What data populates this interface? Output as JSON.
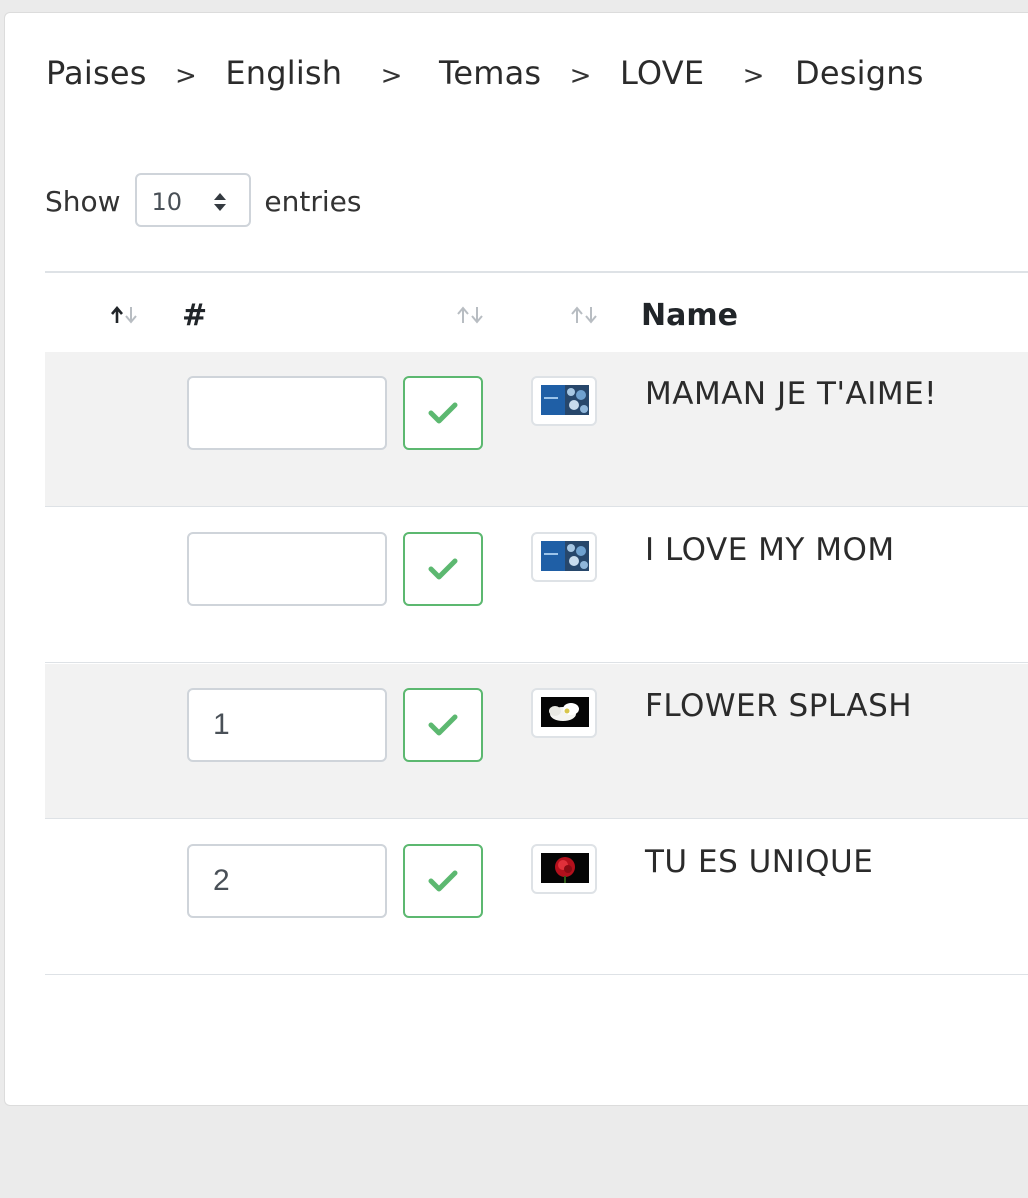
{
  "breadcrumb": {
    "items": [
      "Paises",
      "English",
      "Temas",
      "LOVE",
      "Designs"
    ],
    "separator": ">"
  },
  "length_control": {
    "show_label": "Show",
    "selected_value": "10",
    "entries_label": "entries"
  },
  "table": {
    "columns": [
      {
        "key": "sort",
        "label": "",
        "sort_state": "ascending"
      },
      {
        "key": "order",
        "label": "#",
        "sort_state": "none"
      },
      {
        "key": "image",
        "label": "",
        "sort_state": "none"
      },
      {
        "key": "name",
        "label": "Name",
        "sort_state": "none"
      }
    ],
    "rows": [
      {
        "order_value": "",
        "thumbnail": "blue-card-thumbnail",
        "name": "MAMAN JE T'AIME!"
      },
      {
        "order_value": "",
        "thumbnail": "blue-card-thumbnail",
        "name": "I LOVE MY MOM"
      },
      {
        "order_value": "1",
        "thumbnail": "white-flower-thumbnail",
        "name": "FLOWER SPLASH"
      },
      {
        "order_value": "2",
        "thumbnail": "red-rose-thumbnail",
        "name": "TU ES UNIQUE"
      }
    ]
  },
  "colors": {
    "page_background": "#ebebeb",
    "card_background": "#ffffff",
    "stripe": "#f2f2f2",
    "confirm_green": "#5cb870",
    "border": "#dee2e6"
  },
  "icons": {
    "confirm": "check-icon",
    "sort": "sort-arrows-icon",
    "select": "select-arrows-icon"
  }
}
